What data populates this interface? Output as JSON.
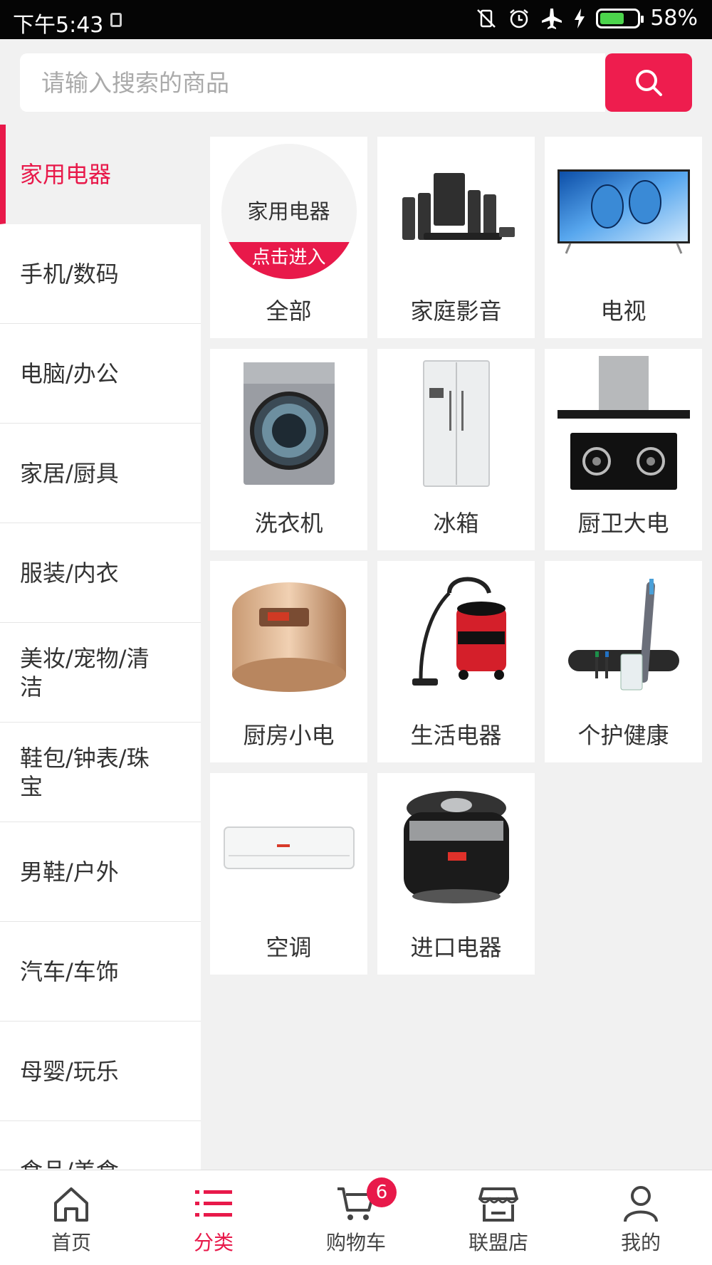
{
  "status": {
    "time": "下午5:43",
    "battery": "58%",
    "battery_level": 0.58
  },
  "search": {
    "placeholder": "请输入搜索的商品"
  },
  "sidebar": {
    "items": [
      {
        "label": "家用电器",
        "active": true
      },
      {
        "label": "手机/数码"
      },
      {
        "label": "电脑/办公"
      },
      {
        "label": "家居/厨具"
      },
      {
        "label": "服装/内衣"
      },
      {
        "label": "美妆/宠物/清洁"
      },
      {
        "label": "鞋包/钟表/珠宝"
      },
      {
        "label": "男鞋/户外"
      },
      {
        "label": "汽车/车饰"
      },
      {
        "label": "母婴/玩乐"
      },
      {
        "label": "食品/美食"
      }
    ]
  },
  "all_card": {
    "title": "家用电器",
    "enter": "点击进入"
  },
  "grid": {
    "items": [
      {
        "label": "全部",
        "icon": "all-category-icon"
      },
      {
        "label": "家庭影音",
        "icon": "home-theater-icon"
      },
      {
        "label": "电视",
        "icon": "tv-icon"
      },
      {
        "label": "洗衣机",
        "icon": "washing-machine-icon"
      },
      {
        "label": "冰箱",
        "icon": "fridge-icon"
      },
      {
        "label": "厨卫大电",
        "icon": "range-hood-icon"
      },
      {
        "label": "厨房小电",
        "icon": "rice-cooker-icon"
      },
      {
        "label": "生活电器",
        "icon": "vacuum-icon"
      },
      {
        "label": "个护健康",
        "icon": "toothbrush-icon"
      },
      {
        "label": "空调",
        "icon": "air-conditioner-icon"
      },
      {
        "label": "进口电器",
        "icon": "pressure-cooker-icon"
      }
    ]
  },
  "nav": {
    "items": [
      {
        "label": "首页",
        "icon": "home-icon"
      },
      {
        "label": "分类",
        "icon": "category-icon",
        "active": true
      },
      {
        "label": "购物车",
        "icon": "cart-icon",
        "badge": "6"
      },
      {
        "label": "联盟店",
        "icon": "store-icon"
      },
      {
        "label": "我的",
        "icon": "profile-icon"
      }
    ]
  },
  "colors": {
    "accent": "#e8194a",
    "search_button": "#ee1d4e",
    "status_bar": "#050505",
    "background": "#f1f1f1"
  }
}
